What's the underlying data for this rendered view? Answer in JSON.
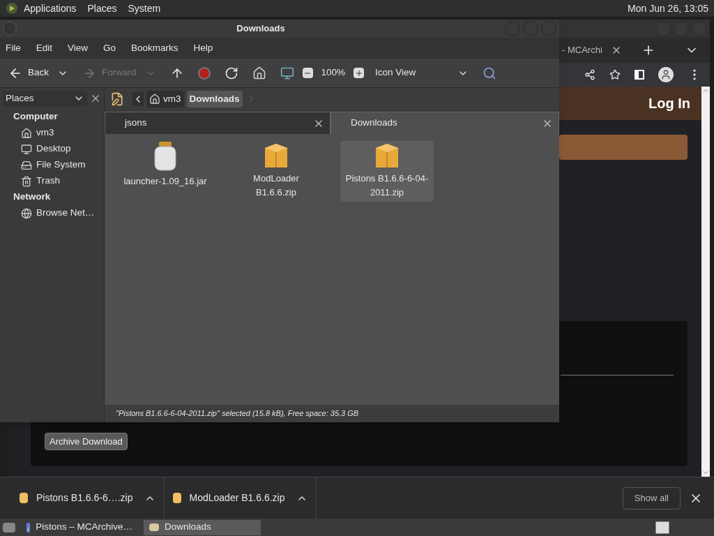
{
  "top_panel": {
    "menus": [
      "Applications",
      "Places",
      "System"
    ],
    "clock": "Mon Jun 26, 13:05"
  },
  "browser": {
    "tab_title": "- MCArchi",
    "login": "Log In",
    "archive_button": "Archive Download"
  },
  "file_manager": {
    "title": "Downloads",
    "menu": [
      "File",
      "Edit",
      "View",
      "Go",
      "Bookmarks",
      "Help"
    ],
    "toolbar": {
      "back": {
        "label": "Back",
        "disabled": false
      },
      "forward": {
        "label": "Forward",
        "disabled": true
      },
      "zoom": "100%",
      "view": "Icon View"
    },
    "sidebar": {
      "header": "Places",
      "sections": [
        {
          "title": "Computer",
          "items": [
            {
              "label": "vm3",
              "kind": "home"
            },
            {
              "label": "Desktop",
              "kind": "desktop"
            },
            {
              "label": "File System",
              "kind": "drive"
            },
            {
              "label": "Trash",
              "kind": "trash"
            }
          ]
        },
        {
          "title": "Network",
          "items": [
            {
              "label": "Browse Net…",
              "kind": "network"
            }
          ]
        }
      ]
    },
    "path": [
      {
        "label": "vm3",
        "selected": false
      },
      {
        "label": "Downloads",
        "selected": true
      }
    ],
    "tabs": [
      {
        "label": "jsons",
        "selected": false
      },
      {
        "label": "Downloads",
        "selected": true
      }
    ],
    "files": [
      {
        "name": "launcher-1.09_16.jar",
        "kind": "jar",
        "selected": false
      },
      {
        "name": "ModLoader B1.6.6.zip",
        "kind": "zip",
        "selected": false
      },
      {
        "name": "Pistons B1.6.6-6-04-2011.zip",
        "kind": "zip",
        "selected": true
      }
    ],
    "status": "\"Pistons B1.6.6-6-04-2011.zip\" selected (15.8 kB), Free space: 35.3 GB"
  },
  "downloads": {
    "items": [
      "Pistons B1.6.6-6….zip",
      "ModLoader B1.6.6.zip"
    ],
    "show_all": "Show all"
  },
  "taskbar": [
    {
      "label": "Pistons – MCArchive…",
      "kind": "browser",
      "selected": false
    },
    {
      "label": "Downloads",
      "kind": "folder",
      "selected": true
    }
  ]
}
